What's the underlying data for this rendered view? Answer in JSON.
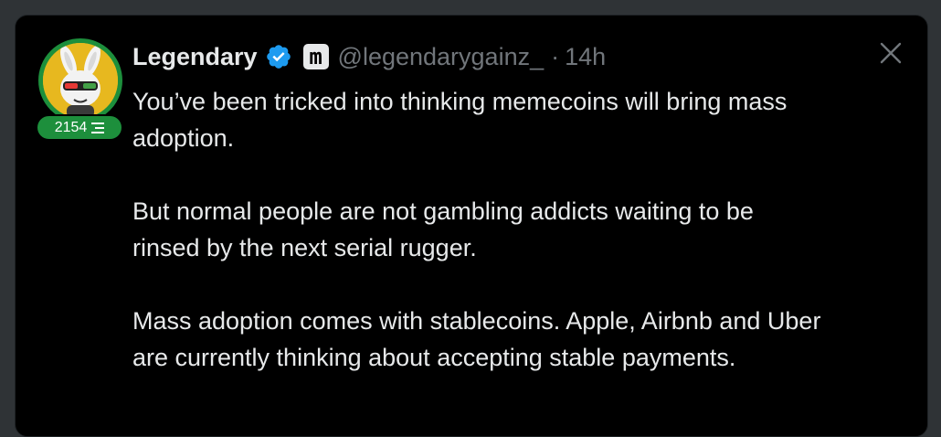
{
  "tweet": {
    "author_name": "Legendary",
    "handle": "@legendarygainz_",
    "separator": "·",
    "time": "14h",
    "badge_level": "2154",
    "paragraphs": [
      "You’ve been tricked into thinking memecoins will bring mass adoption.",
      "But normal people are not gambling addicts waiting to be rinsed by the next serial rugger.",
      "Mass adoption comes with stablecoins. Apple, Airbnb and Uber are currently thinking about accepting stable payments."
    ],
    "affiliate_badge_letter": "m"
  },
  "colors": {
    "background": "#000000",
    "text_primary": "#e7e9ea",
    "text_secondary": "#71767b",
    "verified_blue": "#1d9bf0",
    "level_green": "#1d8f3c",
    "avatar_yellow": "#e7b81f"
  },
  "icons": {
    "verified": "verified-checkmark-icon",
    "affiliate": "affiliate-badge-icon",
    "close": "close-icon",
    "level": "level-bars-icon"
  }
}
